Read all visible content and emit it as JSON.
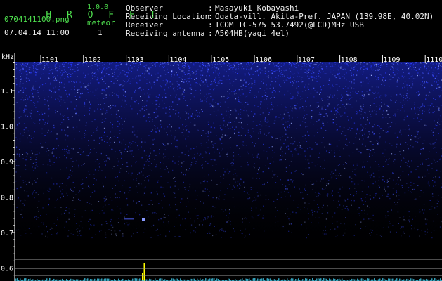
{
  "header": {
    "app_name": "H R O F F T",
    "version": "1.0.0",
    "filename": "0704141100.png",
    "timestamp": "07.04.14 11:00",
    "meteor_label": "meteor",
    "meteor_count": "1",
    "info": [
      {
        "label": "Observer",
        "value": "Masayuki Kobayashi"
      },
      {
        "label": "Receiving Location",
        "value": "Ogata-vill. Akita-Pref. JAPAN (139.98E, 40.02N)"
      },
      {
        "label": "Receiver",
        "value": "ICOM IC-575 53.7492(@LCD)MHz USB"
      },
      {
        "label": "Receiving antenna",
        "value": "A504HB(yagi 4el)"
      }
    ]
  },
  "spectrogram": {
    "unit_label": "kHz",
    "y_ticks": [
      "1.1",
      "1.0",
      "0.9",
      "0.8",
      "0.7",
      "0.6"
    ],
    "x_ticks": [
      "1101",
      "1102",
      "1103",
      "1104",
      "1105",
      "1106",
      "1107",
      "1108",
      "1109",
      "1110"
    ],
    "colors": {
      "background": "#000000",
      "noise": "#2a3cff",
      "axis": "#ffffff",
      "ref_lines": "#9a9a9a",
      "meteor": "#ffff00",
      "baseline": "#3fc9e8"
    }
  }
}
